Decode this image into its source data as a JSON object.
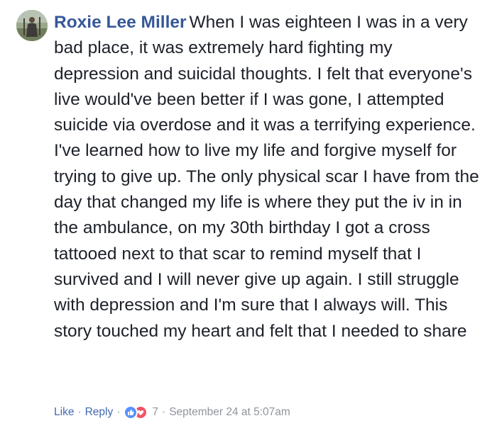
{
  "comment": {
    "author": "Roxie Lee Miller",
    "text": "When I was eighteen I was in a very bad place, it was extremely hard fighting my depression and suicidal thoughts. I felt that everyone's live would've been better if I was gone, I attempted suicide via overdose and it was a terrifying experience. I've learned how to live my life and forgive myself for trying to give up. The only physical scar I have from the day that changed my life is where they put the iv in in the ambulance, on my 30th birthday I got a cross tattooed next to that scar to remind myself that I survived and I will never give up again. I still struggle with depression and I'm sure that I always will. This story touched my heart and felt that I needed to share",
    "actions": {
      "like_label": "Like",
      "separator": "·",
      "reply_label": "Reply",
      "reaction_count": "7",
      "timestamp": "September 24 at 5:07am"
    },
    "reactions": [
      "like-icon",
      "love-icon"
    ]
  },
  "colors": {
    "author_link": "#365899",
    "action_link": "#4267b2",
    "meta_text": "#90949c",
    "body_text": "#1d2129",
    "like_blue": "#5890ff",
    "love_red": "#f25268"
  }
}
